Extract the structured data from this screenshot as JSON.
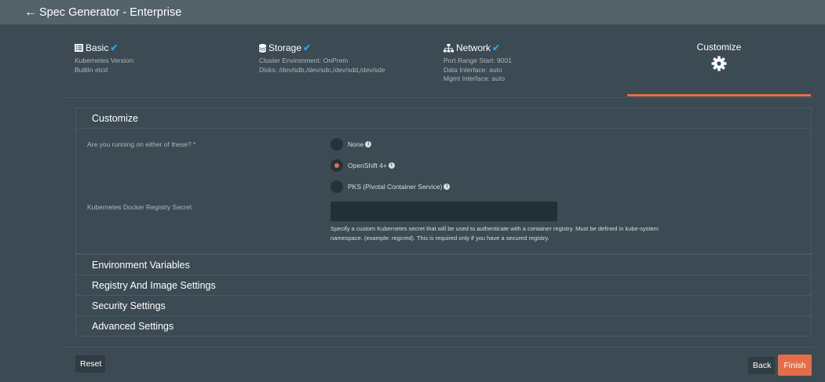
{
  "header": {
    "title": "Spec Generator - Enterprise"
  },
  "steps": {
    "basic": {
      "label": "Basic",
      "lines": [
        "Kubernetes Version:",
        "BuiltIn etcd"
      ]
    },
    "storage": {
      "label": "Storage",
      "lines": [
        "Cluster Environment: OnPrem",
        "Disks: /dev/sdb,/dev/sdc,/dev/sdd,/dev/sde"
      ]
    },
    "network": {
      "label": "Network",
      "lines": [
        "Port Range Start: 9001",
        "Data Interface: auto",
        "Mgmt Interface: auto"
      ]
    },
    "customize": {
      "label": "Customize"
    }
  },
  "customize": {
    "title": "Customize",
    "question": "Are you running on either of these? *",
    "options": [
      {
        "label": "None",
        "selected": false
      },
      {
        "label": "OpenShift 4+",
        "selected": true
      },
      {
        "label": "PKS (Pivotal Container Service)",
        "selected": false
      }
    ],
    "secret": {
      "label": "Kubernetes Docker Registry Secret",
      "value": "",
      "help": "Specify a custom Kubernetes secret that will be used to authenticate with a container registry. Must be defined in kube-system namespace. (example: regcred). This is required only if you have a secured registry."
    }
  },
  "sections": {
    "env": "Environment Variables",
    "registry": "Registry And Image Settings",
    "security": "Security Settings",
    "advanced": "Advanced Settings"
  },
  "buttons": {
    "reset": "Reset",
    "back": "Back",
    "finish": "Finish"
  },
  "colors": {
    "accent": "#e46d49",
    "check": "#29a3e3",
    "background": "#3b4a53",
    "topbar": "#54626a"
  }
}
